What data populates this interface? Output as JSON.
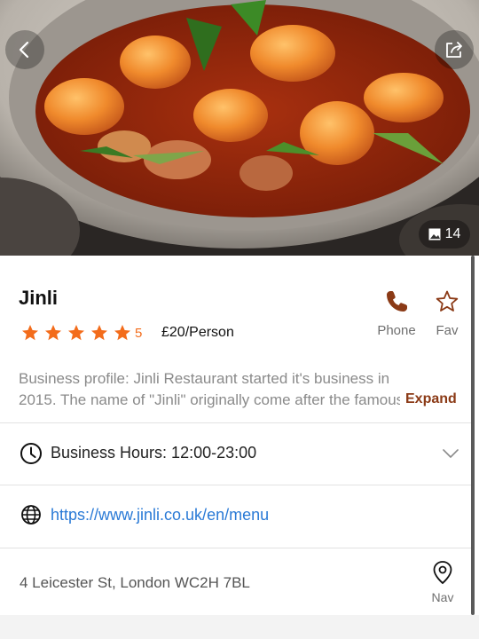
{
  "hero": {
    "photo_count": "14",
    "icons": {
      "back": "chevron-left-icon",
      "share": "share-icon",
      "photos": "image-icon"
    }
  },
  "restaurant": {
    "name": "Jinli",
    "rating_stars": 5,
    "rating_score": "5",
    "price": "£20/Person"
  },
  "actions": {
    "phone_label": "Phone",
    "fav_label": "Fav",
    "nav_label": "Nav"
  },
  "description": {
    "line1": "Business profile: Jinli Restaurant started it's business in",
    "line2": "2015. The name of \"Jinli\" originally come after the famous",
    "expand_label": "Expand"
  },
  "details": {
    "hours": "Business Hours: 12:00-23:00",
    "website": "https://www.jinli.co.uk/en/menu",
    "address": "4 Leicester St, London WC2H 7BL"
  },
  "colors": {
    "accent_orange": "#f36c1b",
    "icon_brown": "#8b3a16",
    "link_blue": "#2a7ad6"
  }
}
